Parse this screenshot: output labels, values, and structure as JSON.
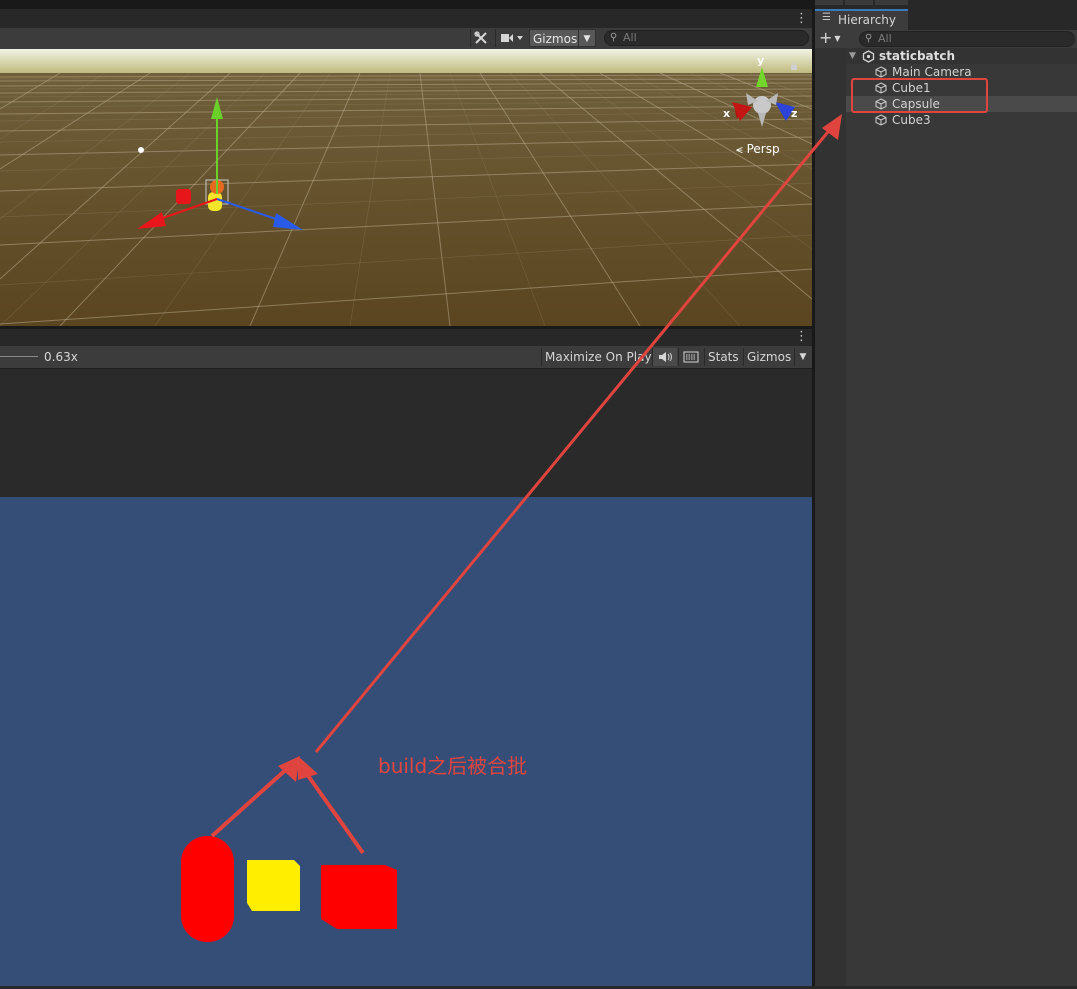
{
  "scene": {
    "toolbar": {
      "gizmos_label": "Gizmos",
      "search_placeholder": "All"
    },
    "gizmo": {
      "y_label": "y",
      "x_label": "x",
      "z_label": "z",
      "persp_label": "⪪ Persp"
    }
  },
  "game": {
    "toolbar": {
      "scale_value": "0.63x",
      "maximize_label": "Maximize On Play",
      "stats_label": "Stats",
      "gizmos_label": "Gizmos"
    }
  },
  "hierarchy": {
    "tab_label": "Hierarchy",
    "search_placeholder": "All",
    "root": "staticbatch",
    "items": [
      {
        "label": "Main Camera"
      },
      {
        "label": "Cube1"
      },
      {
        "label": "Capsule"
      },
      {
        "label": "Cube3"
      }
    ]
  },
  "annotation": {
    "text": "build之后被合批"
  },
  "colors": {
    "annotation_red": "#e0443e",
    "game_background": "#344e78",
    "selection_blue": "#3a79bb"
  }
}
